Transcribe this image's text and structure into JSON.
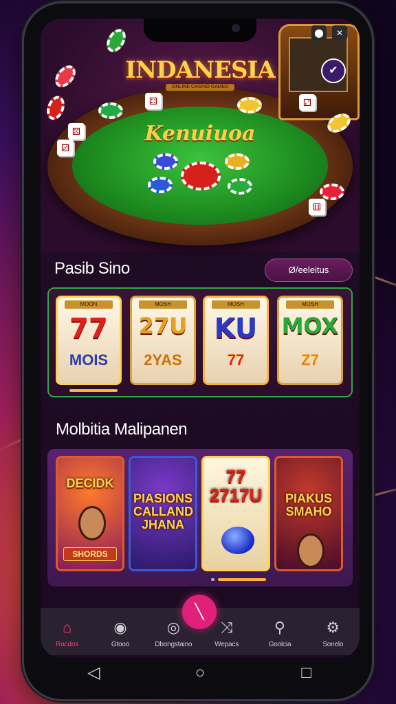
{
  "hero": {
    "brand_title": "INDANESIA",
    "brand_tag": "ONLINE CASINO GAMES",
    "felt_logo": "Kenuiuoa"
  },
  "section1": {
    "title": "Pasib Sino",
    "button_label": "Ø/eeleitus",
    "slots": [
      {
        "top": "MOON",
        "sym1": "77",
        "sym2": "MOIS"
      },
      {
        "top": "MOSH",
        "sym1": "27U",
        "sym2": "2YAS"
      },
      {
        "top": "MOSH",
        "sym1": "KU",
        "sym2": "77"
      },
      {
        "top": "MOSH",
        "sym1": "MOX",
        "sym2": "Z7"
      }
    ]
  },
  "section2": {
    "title": "Molbitia Malipanen",
    "games": [
      {
        "title": "DECIDK",
        "foot": "SHORDS"
      },
      {
        "title": "PIASIONS CALLAND JHANA",
        "foot": ""
      },
      {
        "title": "77 2717U",
        "foot": ""
      },
      {
        "title": "PIAKUS SMAHO",
        "foot": ""
      }
    ]
  },
  "nav": {
    "items": [
      {
        "icon": "home-icon",
        "label": "Racdos"
      },
      {
        "icon": "target-icon",
        "label": "Gtooo"
      },
      {
        "icon": "compass-icon",
        "label": "Dbongstaino"
      },
      {
        "icon": "arrows-icon",
        "label": "Wepacs"
      },
      {
        "icon": "search-icon",
        "label": "Goolcia"
      },
      {
        "icon": "gear-icon",
        "label": "Sonelo"
      }
    ]
  },
  "colors": {
    "accent": "#e0207a",
    "gold": "#ffd24a",
    "felt": "#1d8a1f"
  }
}
